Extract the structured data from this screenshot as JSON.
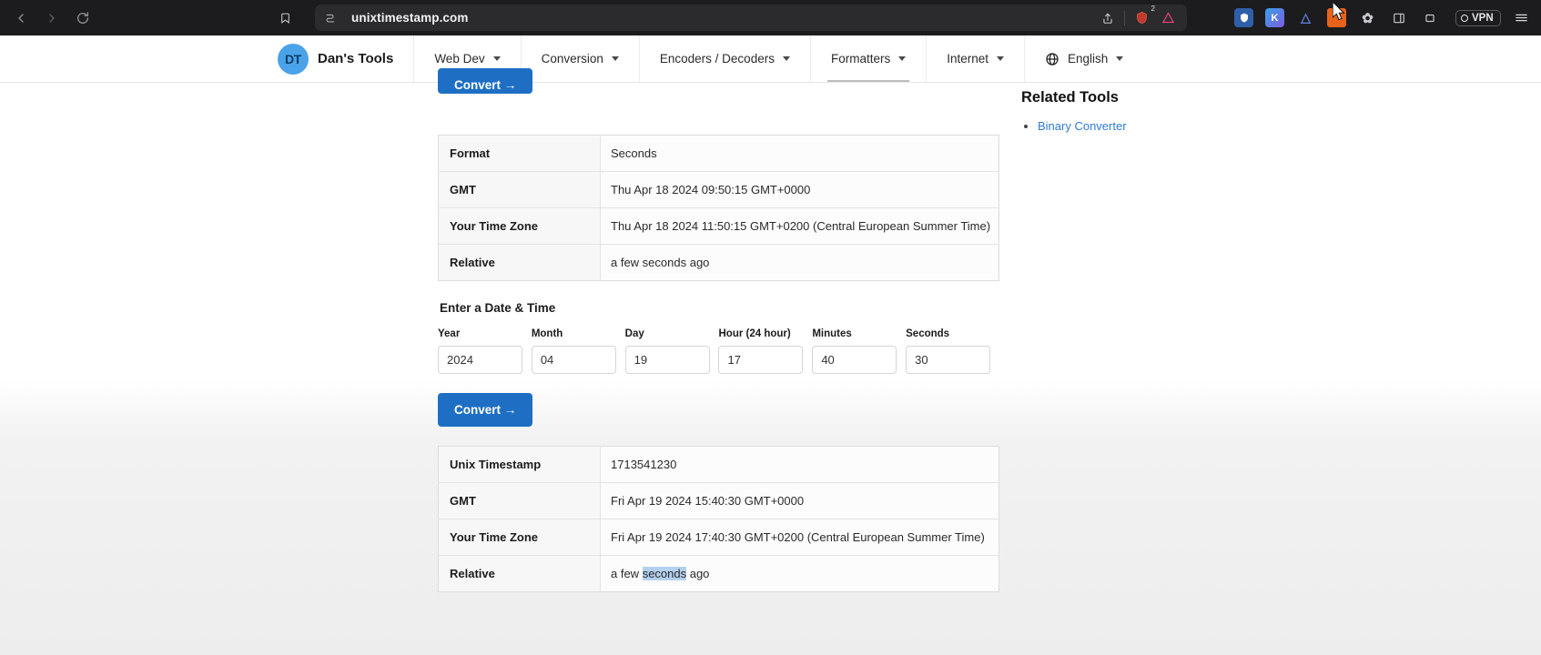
{
  "browser": {
    "back_icon": "chevron-left-icon",
    "forward_icon": "chevron-right-icon",
    "reload_icon": "reload-icon",
    "bookmark_icon": "bookmark-icon",
    "url": "unixtimestamp.com",
    "shield_icon": "tracker-shield-icon",
    "share_icon": "share-icon",
    "extension_badge_count": "2",
    "vpn_label": "VPN",
    "menu_icon": "hamburger-menu-icon",
    "extensions": [
      {
        "name": "ublock-origin-extension",
        "glyph": "U",
        "color": "#2f5fa8"
      },
      {
        "name": "kagi-extension",
        "glyph": "K",
        "color": "#3aa0e8"
      },
      {
        "name": "triangle-extension",
        "glyph": "△",
        "color": "#2a2a4a"
      },
      {
        "name": "fox-extension",
        "glyph": "ᾘa",
        "color": "#e8621a"
      },
      {
        "name": "puzzle-extension",
        "glyph": "✿",
        "color": "#3a3a3e"
      },
      {
        "name": "sidebar-extension",
        "glyph": "▧",
        "color": "#3a3a3e"
      },
      {
        "name": "capture-extension",
        "glyph": "▣",
        "color": "#3a3a3e"
      }
    ]
  },
  "site_nav": {
    "brand_initials": "DT",
    "brand_name": "Dan's Tools",
    "items": [
      {
        "label": "Web Dev",
        "has_caret": true,
        "active": false
      },
      {
        "label": "Conversion",
        "has_caret": true,
        "active": false
      },
      {
        "label": "Encoders / Decoders",
        "has_caret": true,
        "active": false
      },
      {
        "label": "Formatters",
        "has_caret": true,
        "active": true
      },
      {
        "label": "Internet",
        "has_caret": true,
        "active": false
      }
    ],
    "language": {
      "label": "English",
      "has_caret": true,
      "icon": "globe-icon"
    }
  },
  "main": {
    "top_convert_label": "Convert →",
    "result_table_top": {
      "rows": [
        {
          "label": "Format",
          "value": "Seconds"
        },
        {
          "label": "GMT",
          "value": "Thu Apr 18 2024 09:50:15 GMT+0000"
        },
        {
          "label": "Your Time Zone",
          "value": "Thu Apr 18 2024 11:50:15 GMT+0200 (Central European Summer Time)"
        },
        {
          "label": "Relative",
          "value": "a few seconds ago"
        }
      ]
    },
    "form": {
      "title": "Enter a Date & Time",
      "fields": [
        {
          "label": "Year",
          "value": "2024"
        },
        {
          "label": "Month",
          "value": "04"
        },
        {
          "label": "Day",
          "value": "19"
        },
        {
          "label": "Hour (24 hour)",
          "value": "17"
        },
        {
          "label": "Minutes",
          "value": "40"
        },
        {
          "label": "Seconds",
          "value": "30"
        }
      ],
      "convert_label": "Convert →"
    },
    "result_table_bottom": {
      "rows": [
        {
          "label": "Unix Timestamp",
          "value": "1713541230"
        },
        {
          "label": "GMT",
          "value": "Fri Apr 19 2024 15:40:30 GMT+0000"
        },
        {
          "label": "Your Time Zone",
          "value": "Fri Apr 19 2024 17:40:30 GMT+0200 (Central European Summer Time)"
        }
      ],
      "relative_row": {
        "label": "Relative",
        "prefix": "a few ",
        "selected": "seconds",
        "suffix": " ago"
      }
    }
  },
  "sidebar": {
    "title": "Related Tools",
    "links": [
      {
        "label": "Binary Converter"
      }
    ]
  },
  "colors": {
    "accent_blue": "#1e6fc4",
    "link_blue": "#2f7bd4",
    "selection_blue": "#b4d0ef",
    "brand_blue": "#4aa3e8",
    "chrome_bg": "#1c1c1e"
  }
}
